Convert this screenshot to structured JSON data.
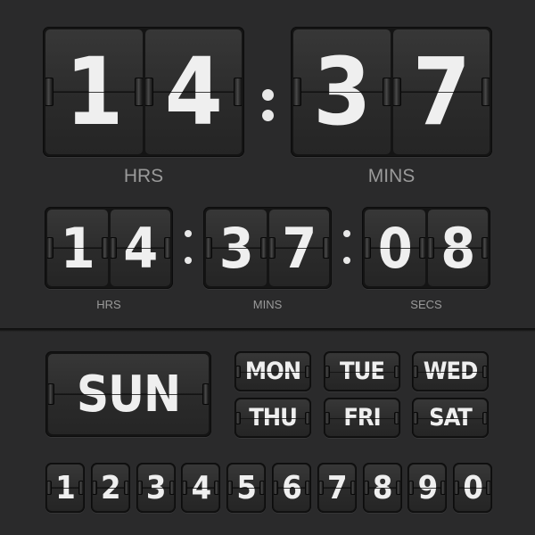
{
  "large_clock": {
    "hours": [
      "1",
      "4"
    ],
    "minutes": [
      "3",
      "7"
    ],
    "hours_label": "HRS",
    "minutes_label": "MINS"
  },
  "small_clock": {
    "hours": [
      "1",
      "4"
    ],
    "minutes": [
      "3",
      "7"
    ],
    "seconds": [
      "0",
      "8"
    ],
    "hours_label": "HRS",
    "minutes_label": "MINS",
    "seconds_label": "SECS"
  },
  "weekday_current": "SUN",
  "weekdays": [
    "MON",
    "TUE",
    "WED",
    "THU",
    "FRI",
    "SAT"
  ],
  "digits": [
    "1",
    "2",
    "3",
    "4",
    "5",
    "6",
    "7",
    "8",
    "9",
    "0"
  ]
}
